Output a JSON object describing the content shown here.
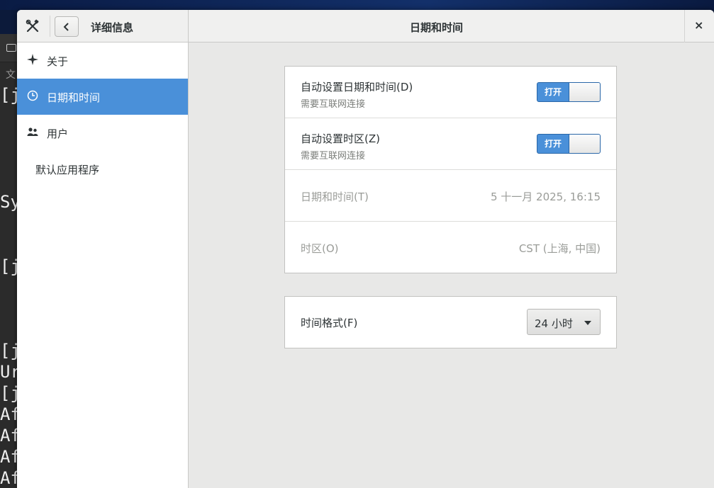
{
  "terminal": {
    "menu_glyph": "文",
    "lines": [
      "[j",
      "Sy",
      "[j",
      "[j",
      "Ur",
      "[j",
      "Af",
      "Af",
      "Af",
      "Af"
    ]
  },
  "headerbar": {
    "sidebar_title": "详细信息",
    "page_title": "日期和时间",
    "close_label": "×"
  },
  "sidebar": {
    "items": [
      {
        "label": "关于",
        "icon": "sparkle-icon"
      },
      {
        "label": "日期和时间",
        "icon": "clock-icon",
        "selected": true
      },
      {
        "label": "用户",
        "icon": "users-icon"
      },
      {
        "label": "默认应用程序"
      }
    ]
  },
  "datetime": {
    "auto_datetime": {
      "title": "自动设置日期和时间(D)",
      "subtitle": "需要互联网连接",
      "switch_label": "打开",
      "on": true
    },
    "auto_timezone": {
      "title": "自动设置时区(Z)",
      "subtitle": "需要互联网连接",
      "switch_label": "打开",
      "on": true
    },
    "date_time": {
      "title": "日期和时间(T)",
      "value": "5 十一月 2025, 16:15"
    },
    "timezone": {
      "title": "时区(O)",
      "value": "CST (上海, 中国)"
    }
  },
  "time_format": {
    "title": "时间格式(F)",
    "selected": "24 小时"
  },
  "colors": {
    "accent": "#4a90d9",
    "window_bg": "#e8e8e7"
  }
}
